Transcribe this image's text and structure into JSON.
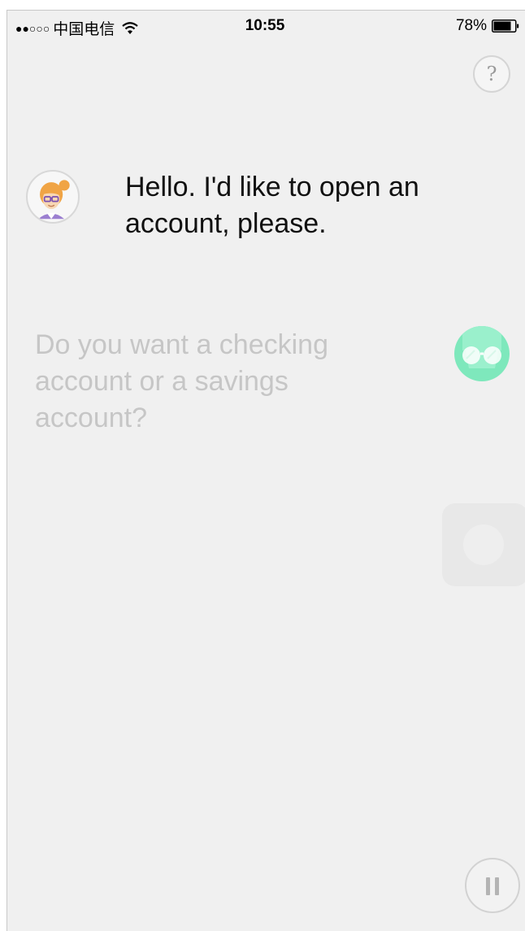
{
  "status_bar": {
    "signal": "●●○○○",
    "carrier": "中国电信",
    "time": "10:55",
    "battery": "78%"
  },
  "help": {
    "label": "?"
  },
  "messages": [
    {
      "speaker": "customer",
      "text": "Hello. I'd like to open an account, please.",
      "state": "active"
    },
    {
      "speaker": "agent",
      "text": "Do you want a checking account or a savings account?",
      "state": "upcoming"
    }
  ],
  "colors": {
    "background": "#f0f0f0",
    "active_text": "#111111",
    "inactive_text": "#c6c6c6",
    "agent_avatar": "#7ee8bc"
  },
  "icons": {
    "help": "question-icon",
    "customer_avatar": "woman-avatar-icon",
    "agent_avatar": "glasses-avatar-icon",
    "record": "record-icon",
    "pause": "pause-icon",
    "wifi": "wifi-icon",
    "battery": "battery-icon"
  }
}
